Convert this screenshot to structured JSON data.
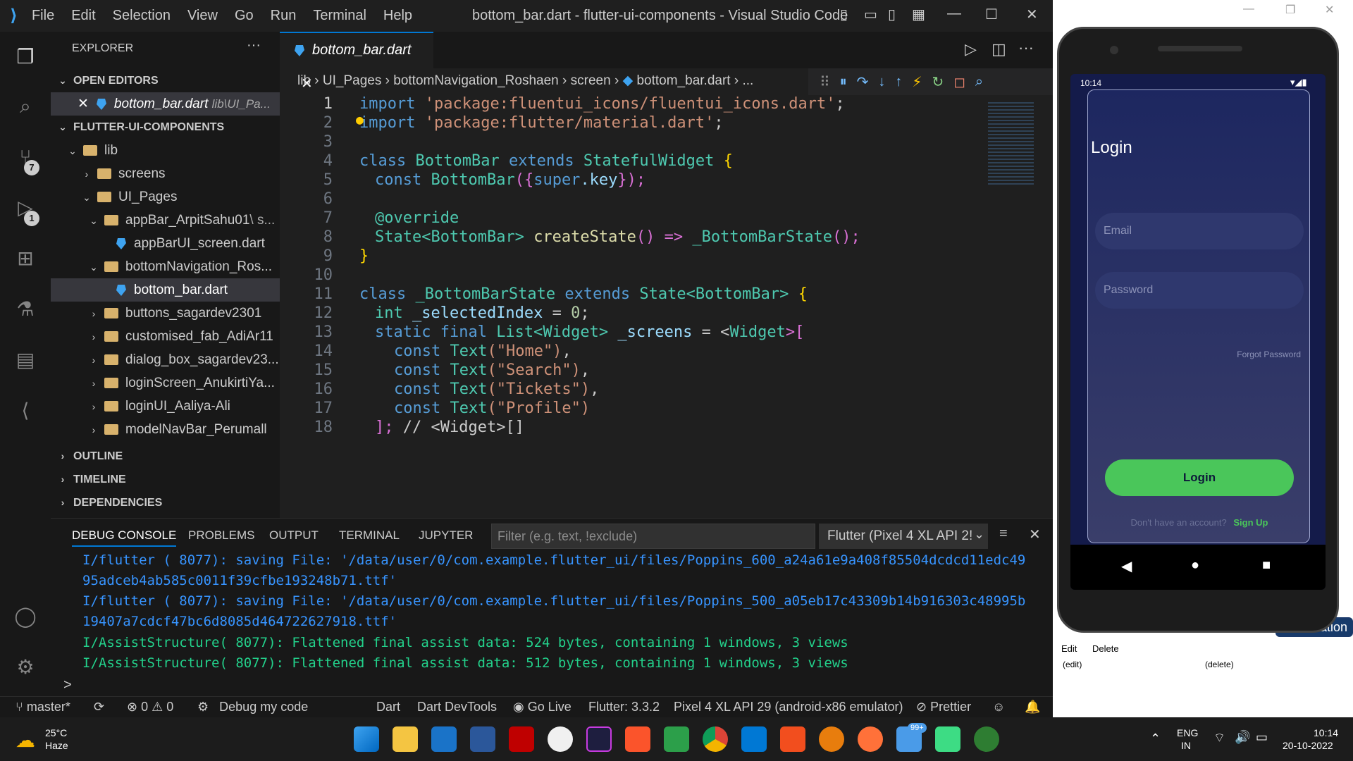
{
  "vscode": {
    "window_title": "bottom_bar.dart - flutter-ui-components - Visual Studio Code",
    "menu": [
      "File",
      "Edit",
      "Selection",
      "View",
      "Go",
      "Run",
      "Terminal",
      "Help"
    ],
    "activity_badges": {
      "source_control": "7",
      "debug": "1"
    },
    "sidebar": {
      "title": "EXPLORER",
      "open_editors_label": "OPEN EDITORS",
      "open_file": "bottom_bar.dart",
      "open_file_path": "lib\\UI_Pa...",
      "project_label": "FLUTTER-UI-COMPONENTS",
      "tree": {
        "lib": "lib",
        "screens": "screens",
        "ui_pages": "UI_Pages",
        "appbar_folder": "appBar_ArpitSahu01",
        "appbar_folder_suffix": "\\ s...",
        "appbar_file": "appBarUI_screen.dart",
        "bottomnav_folder": "bottomNavigation_Ros...",
        "bottomnav_file": "bottom_bar.dart",
        "f1": "buttons_sagardev2301",
        "f2": "customised_fab_AdiAr11",
        "f3": "dialog_box_sagardev23...",
        "f4": "loginScreen_AnukirtiYa...",
        "f5": "loginUI_Aaliya-Ali",
        "f6": "modelNavBar_Perumall"
      },
      "outline": "OUTLINE",
      "timeline": "TIMELINE",
      "dependencies": "DEPENDENCIES"
    },
    "tab_label": "bottom_bar.dart",
    "breadcrumb": [
      "lib",
      "UI_Pages",
      "bottomNavigation_Roshaen",
      "screen",
      "bottom_bar.dart",
      "..."
    ],
    "line_numbers": [
      "1",
      "2",
      "3",
      "4",
      "5",
      "6",
      "7",
      "8",
      "9",
      "10",
      "11",
      "12",
      "13",
      "14",
      "15",
      "16",
      "17",
      "18"
    ],
    "code": {
      "l1_kw": "import",
      "l1_str": "'package:fluentui_icons/fluentui_icons.dart'",
      "l1_end": ";",
      "l2_kw": "import",
      "l2_str": "'package:flutter/material.dart'",
      "l2_end": ";",
      "l4_a": "class ",
      "l4_b": "BottomBar",
      "l4_c": " extends ",
      "l4_d": "StatefulWidget",
      "l4_e": " {",
      "l5_a": "const ",
      "l5_b": "BottomBar",
      "l5_c": "({",
      "l5_d": "super",
      "l5_e": ".key",
      "l5_f": "});",
      "l7": "@override",
      "l8_a": "State",
      "l8_b": "<BottomBar> ",
      "l8_c": "createState",
      "l8_d": "() => ",
      "l8_e": "_BottomBarState",
      "l8_f": "();",
      "l9": "}",
      "l11_a": "class ",
      "l11_b": "_BottomBarState",
      "l11_c": " extends ",
      "l11_d": "State",
      "l11_e": "<BottomBar>",
      "l11_f": " {",
      "l12_a": "int ",
      "l12_b": "_selectedIndex",
      "l12_c": " = ",
      "l12_d": "0",
      "l12_e": ";",
      "l13_a": "static final ",
      "l13_b": "List",
      "l13_c": "<Widget>",
      "l13_d": " _screens",
      "l13_e": " = <",
      "l13_f": "Widget",
      "l13_g": ">[",
      "l14_a": "const ",
      "l14_b": "Text",
      "l14_c": "(\"Home\")",
      "l14_d": ",",
      "l15_a": "const ",
      "l15_b": "Text",
      "l15_c": "(\"Search\")",
      "l15_d": ",",
      "l16_a": "const ",
      "l16_b": "Text",
      "l16_c": "(\"Tickets\")",
      "l16_d": ",",
      "l17_a": "const ",
      "l17_b": "Text",
      "l17_c": "(\"Profile\")",
      "l18_a": "];",
      "l18_b": " // <Widget>[]"
    },
    "panel": {
      "tabs": [
        "DEBUG CONSOLE",
        "PROBLEMS",
        "OUTPUT",
        "TERMINAL",
        "JUPYTER"
      ],
      "filter_placeholder": "Filter (e.g. text, !exclude)",
      "device_select": "Flutter (Pixel 4 XL API 2!",
      "logs": [
        "I/flutter ( 8077): saving File: '/data/user/0/com.example.flutter_ui/files/Poppins_600_a24a61e9a408f85504dcdcd11edc49",
        "95adceb4ab585c0011f39cfbe193248b71.ttf'",
        "I/flutter ( 8077): saving File: '/data/user/0/com.example.flutter_ui/files/Poppins_500_a05eb17c43309b14b916303c48995b",
        "19407a7cdcf47bc6d8085d464722627918.ttf'",
        "I/AssistStructure( 8077): Flattened final assist data: 524 bytes, containing 1 windows, 3 views",
        "I/AssistStructure( 8077): Flattened final assist data: 512 bytes, containing 1 windows, 3 views"
      ],
      "prompt": ">"
    },
    "status": {
      "branch": "master*",
      "errors": "0",
      "warnings": "0",
      "debug": "Debug my code",
      "lang": "Dart",
      "devtools": "Dart DevTools",
      "golive": "Go Live",
      "flutter": "Flutter: 3.3.2",
      "device": "Pixel 4 XL API 29 (android-x86 emulator)",
      "prettier": "Prettier"
    }
  },
  "phone": {
    "time": "10:14",
    "title": "Login",
    "email_placeholder": "Email",
    "password_placeholder": "Password",
    "forgot": "Forgot Password",
    "login_button": "Login",
    "no_account": "Don't have an account?",
    "signup": "Sign Up"
  },
  "right_panel": {
    "edit": "Edit",
    "delete": "Delete",
    "edit_sub": "(edit)",
    "delete_sub": "(delete)",
    "partial_label": "ation"
  },
  "taskbar": {
    "temp": "25°C",
    "weather": "Haze",
    "lang1": "ENG",
    "lang2": "IN",
    "time": "10:14",
    "date": "20-10-2022",
    "badge": "99+"
  }
}
